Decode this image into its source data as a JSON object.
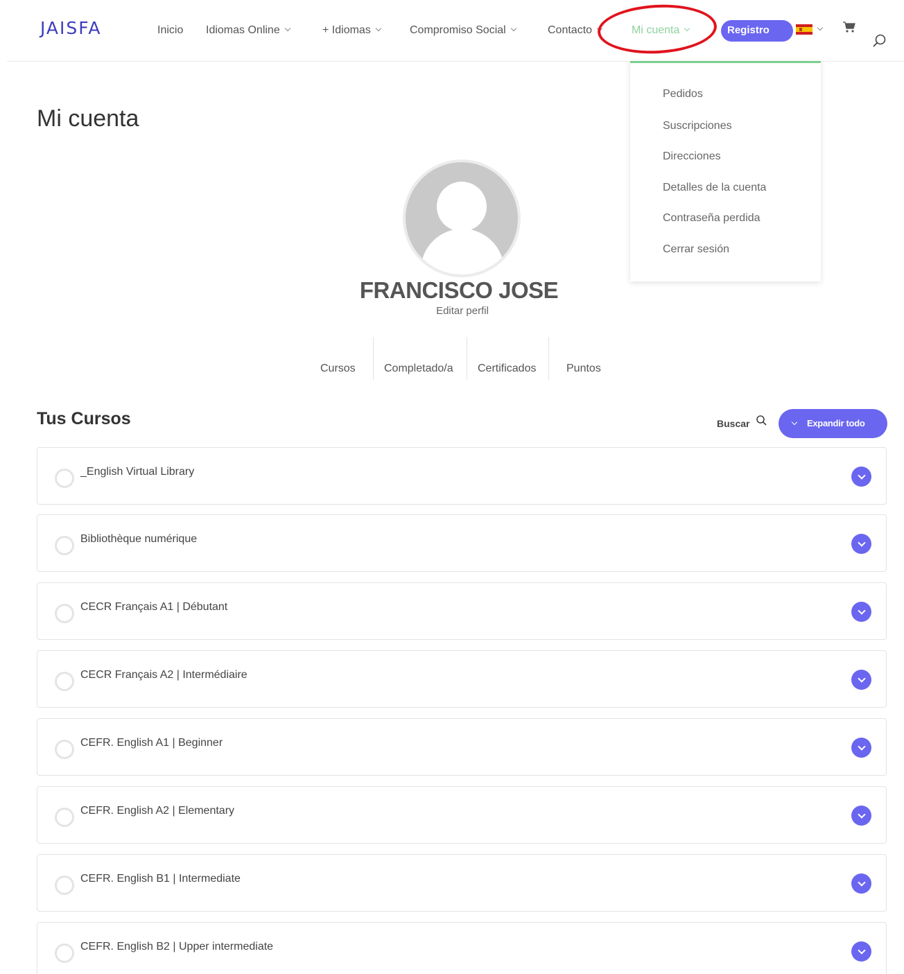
{
  "header": {
    "logo": "JAISFA",
    "nav": [
      {
        "label": "Inicio",
        "has_dropdown": false
      },
      {
        "label": "Idiomas Online",
        "has_dropdown": true
      },
      {
        "label": "+ Idiomas",
        "has_dropdown": true
      },
      {
        "label": "Compromiso Social",
        "has_dropdown": true
      },
      {
        "label": "Contacto",
        "has_dropdown": true
      },
      {
        "label": "Mi cuenta",
        "has_dropdown": true,
        "active": true
      }
    ],
    "registro_label": "Registro",
    "language": "es",
    "icons": {
      "cart": "cart-icon",
      "search": "search-icon"
    }
  },
  "dropdown": {
    "items": [
      {
        "label": "Pedidos"
      },
      {
        "label": "Suscripciones"
      },
      {
        "label": "Direcciones"
      },
      {
        "label": "Detalles de la cuenta"
      },
      {
        "label": "Contraseña perdida"
      },
      {
        "label": "Cerrar sesión"
      }
    ]
  },
  "page": {
    "title": "Mi cuenta"
  },
  "profile": {
    "name": "FRANCISCO JOSE",
    "edit_label": "Editar perfil",
    "tabs": [
      {
        "label": "Cursos"
      },
      {
        "label": "Completado/a"
      },
      {
        "label": "Certificados"
      },
      {
        "label": "Puntos"
      }
    ]
  },
  "courses": {
    "title": "Tus Cursos",
    "search_label": "Buscar",
    "expand_label": "Expandir todo",
    "items": [
      {
        "title": "_English Virtual Library"
      },
      {
        "title": "Bibliothèque numérique"
      },
      {
        "title": "CECR Français A1 | Débutant"
      },
      {
        "title": "CECR Français A2 | Intermédiaire"
      },
      {
        "title": "CEFR. English A1 | Beginner"
      },
      {
        "title": "CEFR. English A2 | Elementary"
      },
      {
        "title": "CEFR. English B1 | Intermediate"
      },
      {
        "title": "CEFR. English B2 | Upper intermediate"
      }
    ]
  },
  "colors": {
    "accent": "#6a66f0",
    "active_nav": "#8fd19e",
    "annotation": "#e0131c",
    "logo": "#3d3dbd"
  }
}
